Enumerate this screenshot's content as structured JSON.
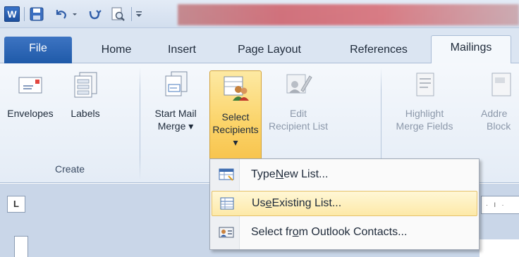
{
  "ribbon_tabs": {
    "file": "File",
    "home": "Home",
    "insert": "Insert",
    "page_layout": "Page Layout",
    "references": "References",
    "mailings": "Mailings"
  },
  "groups": {
    "create": {
      "label": "Create",
      "envelopes": "Envelopes",
      "labels": "Labels"
    },
    "start_mail_merge": {
      "start_line1": "Start Mail",
      "start_line2": "Merge ▾",
      "select_line1": "Select",
      "select_line2": "Recipients ▾",
      "edit_line1": "Edit",
      "edit_line2": "Recipient List"
    },
    "write_insert": {
      "highlight_line1": "Highlight",
      "highlight_line2": "Merge Fields",
      "address_line1": "Addre",
      "address_line2": "Block"
    }
  },
  "menu": {
    "type_new": {
      "pre": "Type ",
      "key": "N",
      "post": "ew List..."
    },
    "use_existing": {
      "pre": "Us",
      "key": "e",
      "post": " Existing List..."
    },
    "outlook": {
      "pre": "Select fr",
      "key": "o",
      "post": "m Outlook Contacts..."
    }
  },
  "misc": {
    "word_logo": "W",
    "ruler_tab_marker": "L",
    "ruler_ticks": "· I ·"
  },
  "icons": [
    "word-icon",
    "save-icon",
    "undo-icon",
    "redo-icon",
    "print-preview-icon",
    "customize-qat-icon",
    "envelope-icon",
    "labels-icon",
    "start-mail-merge-icon",
    "select-recipients-icon",
    "edit-recipient-list-icon",
    "highlight-merge-fields-icon",
    "address-block-icon",
    "type-new-list-icon",
    "existing-list-icon",
    "outlook-contacts-icon"
  ],
  "colors": {
    "accent_file_tab": "#1f5aa9",
    "pressed_highlight": "#fbd46a",
    "hover_highlight": "#fde9a8"
  }
}
